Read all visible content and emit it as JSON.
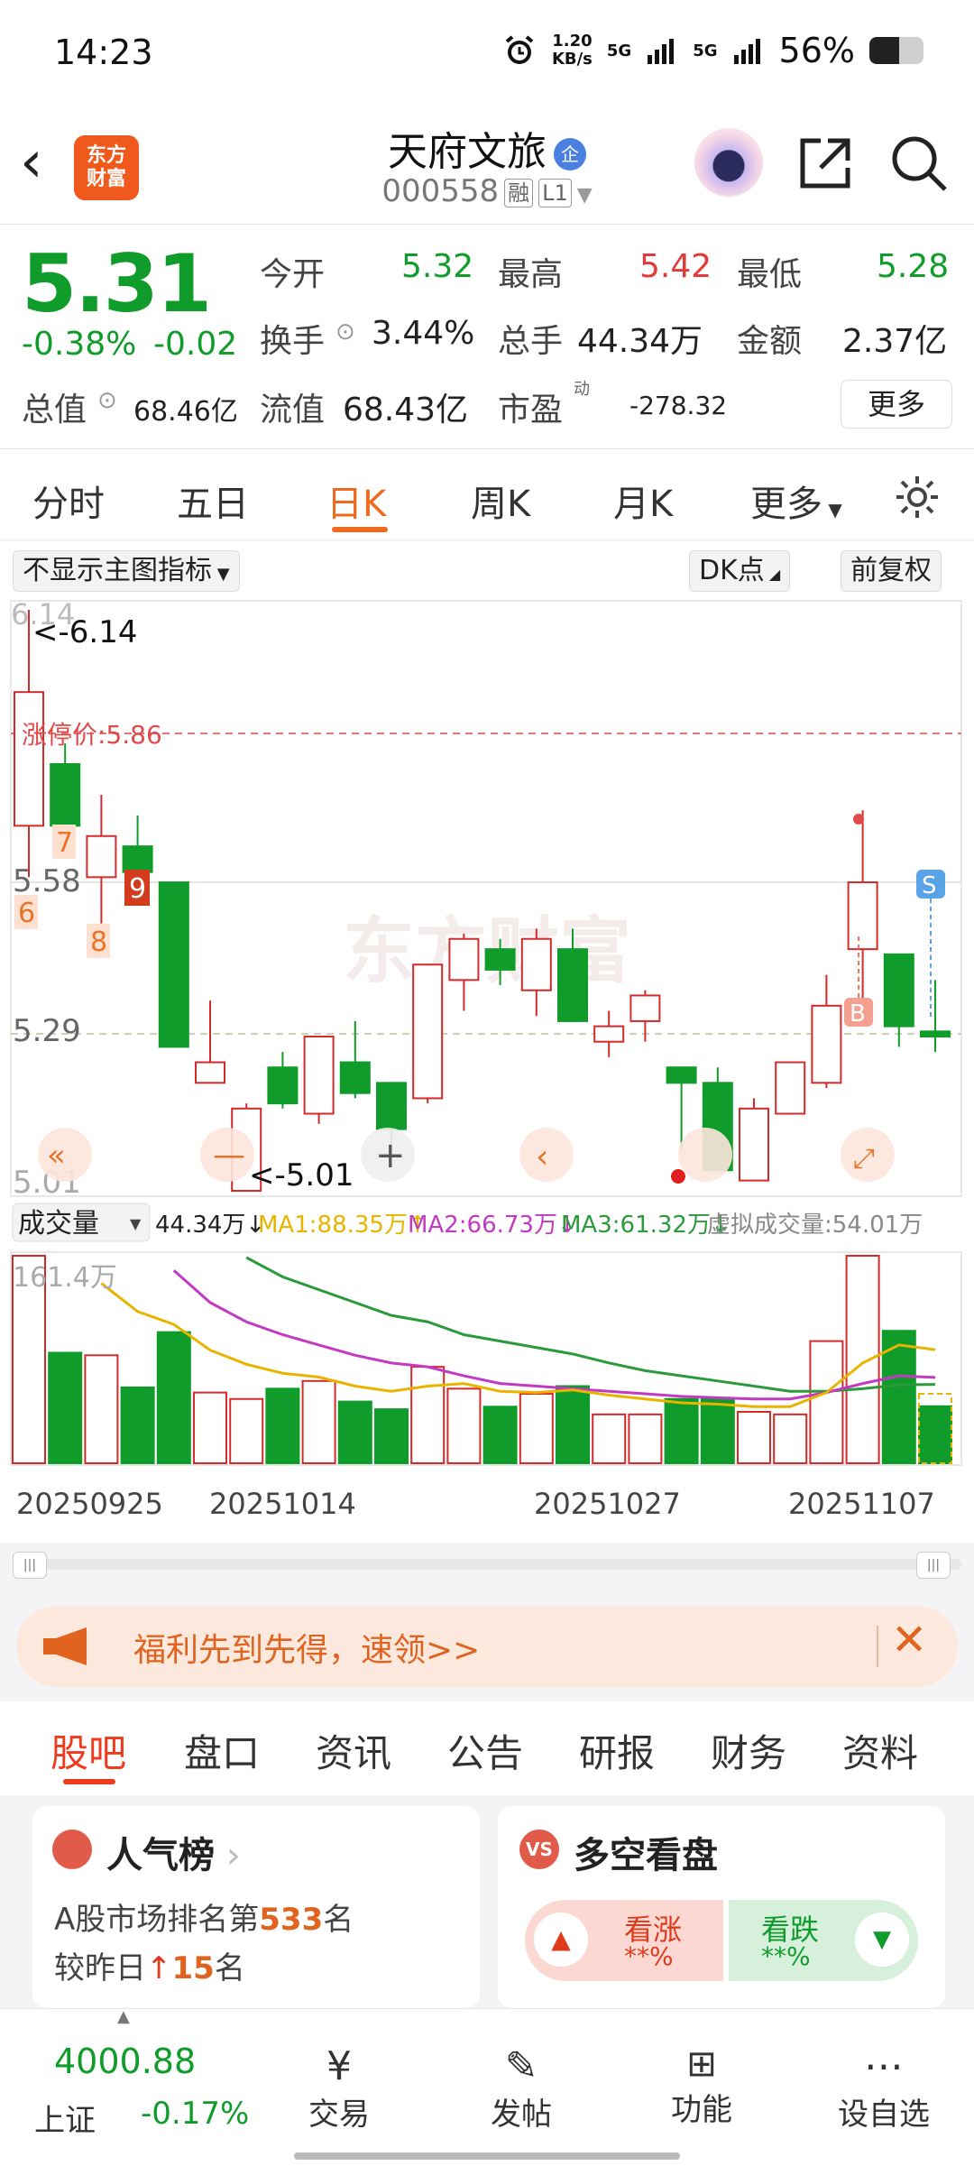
{
  "status": {
    "time": "14:23",
    "net_speed_top": "1.20",
    "net_speed_bottom": "KB/s",
    "sig1": "5G",
    "sig2": "5G",
    "battery": "56%"
  },
  "header": {
    "logo_line1": "东方",
    "logo_line2": "财富",
    "name": "天府文旅",
    "badge": "企",
    "code": "000558",
    "tag1": "融",
    "tag2": "L1"
  },
  "quote": {
    "price": "5.31",
    "change_pct": "-0.38%",
    "change": "-0.02",
    "open_label": "今开",
    "open": "5.32",
    "high_label": "最高",
    "high": "5.42",
    "low_label": "最低",
    "low": "5.28",
    "turnover_label": "换手",
    "turnover": "3.44%",
    "volume_label": "总手",
    "volume": "44.34万",
    "amount_label": "金额",
    "amount": "2.37亿",
    "mcap_label": "总值",
    "mcap": "68.46亿",
    "float_label": "流值",
    "float": "68.43亿",
    "pe_label": "市盈",
    "pe_sup": "动",
    "pe": "-278.32",
    "more_label": "更多"
  },
  "tabs": {
    "t1": "分时",
    "t2": "五日",
    "t3": "日K",
    "t4": "周K",
    "t5": "月K",
    "t6": "更多"
  },
  "chart_tools": {
    "indicator": "不显示主图指标",
    "dk": "DK点",
    "adjust": "前复权",
    "volume_select": "成交量"
  },
  "chart_text": {
    "ymax": "6.14",
    "ymax_mark": "<-6.14",
    "limit_up": "涨停价:5.86",
    "y558": "5.58",
    "y529": "5.29",
    "ymin": "5.01",
    "ymin_mark": "<-5.01",
    "n7": "7",
    "n6": "6",
    "n8": "8",
    "n9": "9",
    "markB": "B",
    "markS": "S",
    "watermark": "东方财富",
    "vol_now": "44.34万↓",
    "ma1": "MA1:88.35万↑",
    "ma2": "MA2:66.73万↓",
    "ma3": "MA3:61.32万↓",
    "vvol": "虚拟成交量:54.01万",
    "vol_max": "161.4万",
    "d1": "20250925",
    "d2": "20251014",
    "d3": "20251027",
    "d4": "20251107"
  },
  "chart_data": {
    "type": "candlestick",
    "ylim": [
      5.01,
      6.14
    ],
    "limit_up": 5.86,
    "candles": [
      {
        "o": 5.72,
        "h": 6.14,
        "l": 5.62,
        "c": 5.98
      },
      {
        "o": 5.84,
        "h": 5.88,
        "l": 5.7,
        "c": 5.72
      },
      {
        "o": 5.62,
        "h": 5.78,
        "l": 5.53,
        "c": 5.7
      },
      {
        "o": 5.68,
        "h": 5.74,
        "l": 5.62,
        "c": 5.63
      },
      {
        "o": 5.61,
        "h": 5.61,
        "l": 5.29,
        "c": 5.29
      },
      {
        "o": 5.22,
        "h": 5.38,
        "l": 5.22,
        "c": 5.26
      },
      {
        "o": 5.01,
        "h": 5.18,
        "l": 5.01,
        "c": 5.17
      },
      {
        "o": 5.25,
        "h": 5.28,
        "l": 5.17,
        "c": 5.18
      },
      {
        "o": 5.16,
        "h": 5.31,
        "l": 5.14,
        "c": 5.31
      },
      {
        "o": 5.26,
        "h": 5.34,
        "l": 5.19,
        "c": 5.2
      },
      {
        "o": 5.22,
        "h": 5.22,
        "l": 5.1,
        "c": 5.13
      },
      {
        "o": 5.19,
        "h": 5.45,
        "l": 5.18,
        "c": 5.45
      },
      {
        "o": 5.42,
        "h": 5.51,
        "l": 5.36,
        "c": 5.5
      },
      {
        "o": 5.48,
        "h": 5.5,
        "l": 5.41,
        "c": 5.44
      },
      {
        "o": 5.4,
        "h": 5.52,
        "l": 5.35,
        "c": 5.5
      },
      {
        "o": 5.48,
        "h": 5.52,
        "l": 5.34,
        "c": 5.34
      },
      {
        "o": 5.3,
        "h": 5.36,
        "l": 5.27,
        "c": 5.33
      },
      {
        "o": 5.34,
        "h": 5.4,
        "l": 5.3,
        "c": 5.39
      },
      {
        "o": 5.25,
        "h": 5.25,
        "l": 5.09,
        "c": 5.22
      },
      {
        "o": 5.22,
        "h": 5.25,
        "l": 5.05,
        "c": 5.05
      },
      {
        "o": 5.03,
        "h": 5.19,
        "l": 5.03,
        "c": 5.17
      },
      {
        "o": 5.16,
        "h": 5.26,
        "l": 5.16,
        "c": 5.26
      },
      {
        "o": 5.22,
        "h": 5.43,
        "l": 5.21,
        "c": 5.37
      },
      {
        "o": 5.48,
        "h": 5.75,
        "l": 5.36,
        "c": 5.61
      },
      {
        "o": 5.47,
        "h": 5.47,
        "l": 5.29,
        "c": 5.33
      },
      {
        "o": 5.32,
        "h": 5.42,
        "l": 5.28,
        "c": 5.31
      }
    ],
    "volume_ylim": [
      0,
      161.4
    ],
    "volumes": [
      161.4,
      86,
      84,
      59,
      102,
      55,
      50,
      58,
      64,
      48,
      42,
      75,
      58,
      44,
      54,
      60,
      38,
      38,
      50,
      50,
      40,
      38,
      95,
      161.4,
      103,
      44.34
    ],
    "virtual_volume": 54.01,
    "ma1": [
      null,
      null,
      140,
      118,
      108,
      88,
      77,
      70,
      67,
      60,
      56,
      60,
      62,
      56,
      55,
      57,
      53,
      50,
      47,
      46,
      44,
      44,
      55,
      78,
      92,
      88.35
    ],
    "ma2": [
      null,
      null,
      null,
      null,
      150,
      125,
      110,
      100,
      92,
      84,
      78,
      75,
      68,
      62,
      60,
      58,
      56,
      54,
      52,
      51,
      50,
      50,
      55,
      62,
      68,
      66.73
    ],
    "ma3": [
      null,
      null,
      null,
      null,
      null,
      null,
      160,
      145,
      135,
      125,
      115,
      110,
      100,
      95,
      90,
      85,
      78,
      72,
      68,
      64,
      60,
      56,
      56,
      58,
      61,
      61.32
    ]
  },
  "banner": {
    "text": "福利先到先得，速领>>"
  },
  "subtabs": {
    "s1": "股吧",
    "s2": "盘口",
    "s3": "资讯",
    "s4": "公告",
    "s5": "研报",
    "s6": "财务",
    "s7": "资料"
  },
  "cards": {
    "pop_title": "人气榜",
    "pop_line1_pre": "A股市场排名第",
    "pop_rank": "533",
    "pop_line1_post": "名",
    "pop_line2_pre": "较昨日",
    "pop_delta": "15",
    "pop_line2_post": "名",
    "vs_title": "多空看盘",
    "bull": "看涨",
    "bull_pct": "**%",
    "bear": "看跌",
    "bear_pct": "**%"
  },
  "bottom": {
    "index_value": "4000.88",
    "index_name": "上证",
    "index_change": "-0.17%",
    "trade": "交易",
    "post": "发帖",
    "func": "功能",
    "watch": "设自选"
  }
}
